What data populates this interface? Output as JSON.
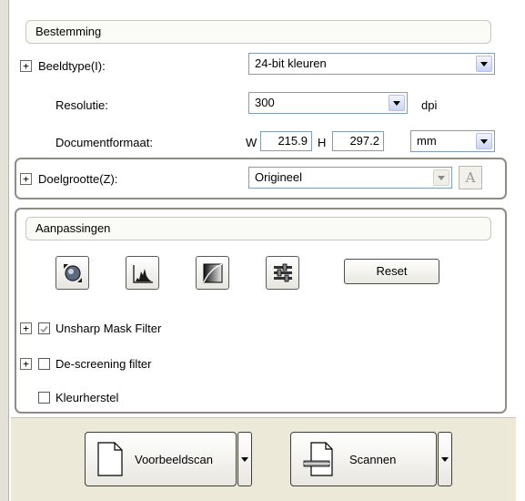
{
  "destination": {
    "header": "Bestemming"
  },
  "image_type": {
    "label": "Beeldtype(I):",
    "value": "24-bit kleuren"
  },
  "resolution": {
    "label": "Resolutie:",
    "value": "300",
    "unit": "dpi"
  },
  "document_size": {
    "label": "Documentformaat:",
    "w_label": "W",
    "w_value": "215.9",
    "h_label": "H",
    "h_value": "297.2",
    "unit": "mm"
  },
  "target_size": {
    "label": "Doelgrootte(Z):",
    "value": "Origineel"
  },
  "adjustments": {
    "header": "Aanpassingen",
    "tools": [
      "auto-exposure-icon",
      "histogram-icon",
      "tone-curve-icon",
      "color-balance-icon"
    ],
    "reset_label": "Reset",
    "unsharp_label": "Unsharp Mask Filter",
    "unsharp_checked": true,
    "descreening_label": "De-screening filter",
    "descreening_checked": false,
    "color_restore_label": "Kleurherstel",
    "color_restore_checked": false
  },
  "buttons": {
    "preview_label": "Voorbeeldscan",
    "scan_label": "Scannen"
  },
  "colors": {
    "select_border": "#7f9db9",
    "frame_border": "#8f8c84",
    "toolbar_bg": "#ece9d8"
  }
}
